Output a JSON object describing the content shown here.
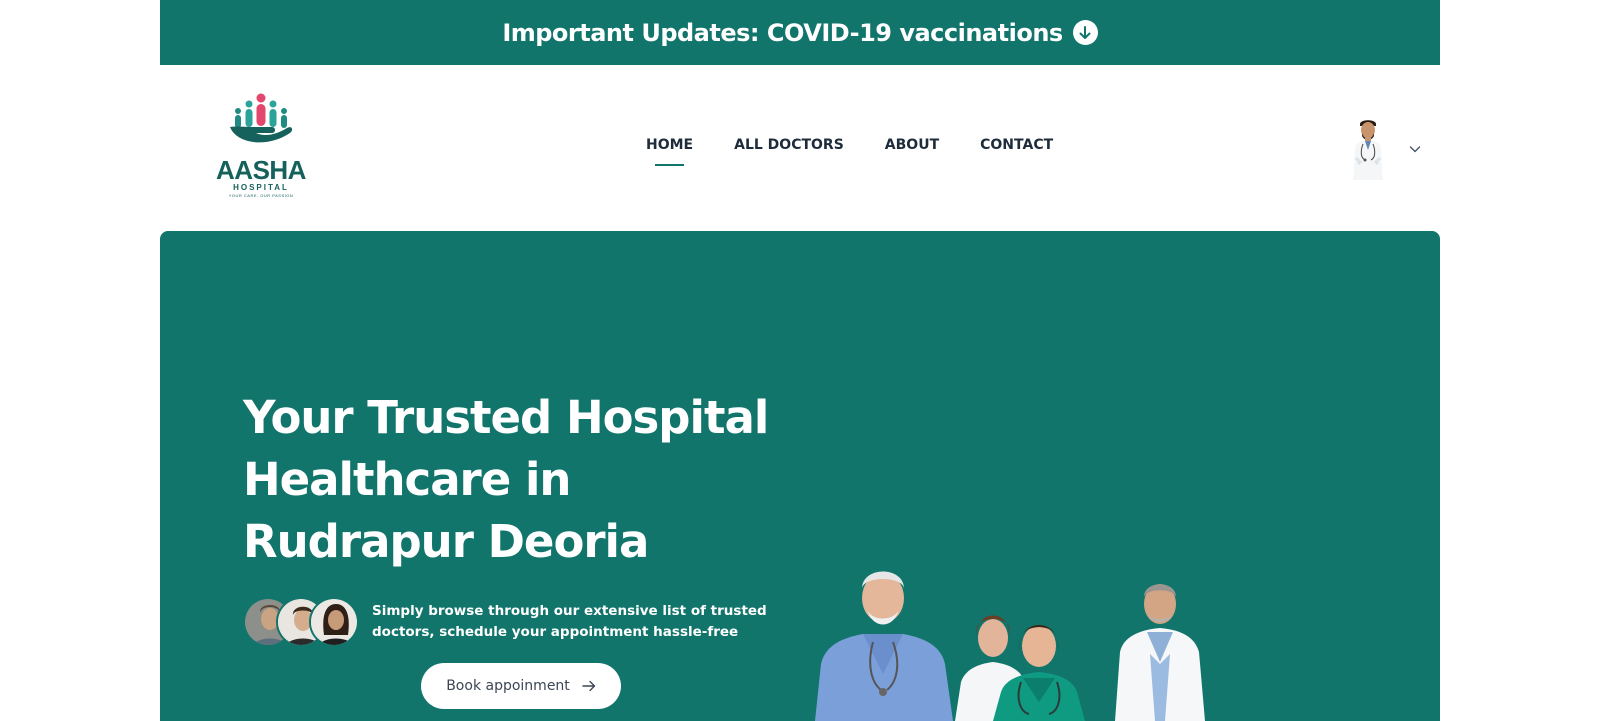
{
  "banner": {
    "text": "Important Updates: COVID-19 vaccinations",
    "icon": "arrow-down-circle-icon"
  },
  "logo": {
    "word": "AASHA",
    "subtitle": "HOSPITAL",
    "tagline": "YOUR CARE, OUR PASSION"
  },
  "nav": {
    "items": [
      {
        "label": "HOME",
        "active": true
      },
      {
        "label": "ALL DOCTORS",
        "active": false
      },
      {
        "label": "ABOUT",
        "active": false
      },
      {
        "label": "CONTACT",
        "active": false
      }
    ]
  },
  "hero": {
    "title": "Your Trusted Hospital Healthcare in Rudrapur Deoria",
    "description": "Simply browse through our extensive list of trusted doctors, schedule your appointment hassle-free",
    "button_label": "Book appoinment",
    "button_icon": "arrow-right-icon"
  },
  "colors": {
    "brand": "#11756c",
    "logo_accent": "#e3476d",
    "text_dark": "#1d2b3a"
  }
}
